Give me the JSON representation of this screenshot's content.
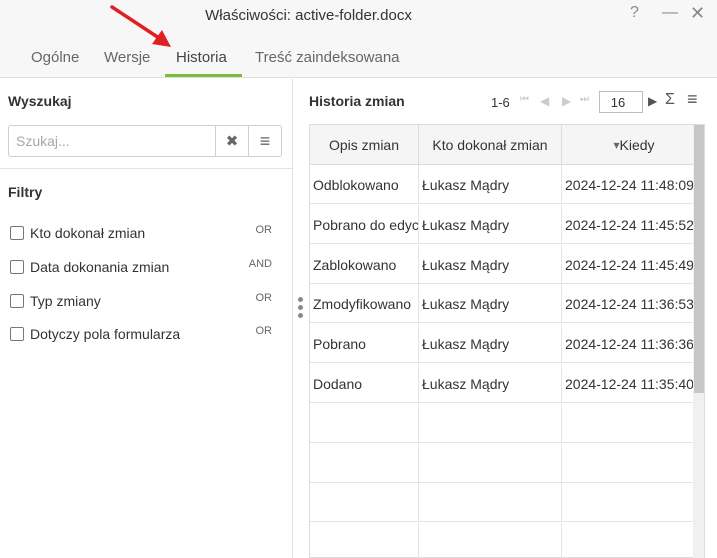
{
  "window": {
    "title": "Właściwości: active-folder.docx"
  },
  "tabs": [
    {
      "label": "Ogólne"
    },
    {
      "label": "Wersje"
    },
    {
      "label": "Historia"
    },
    {
      "label": "Treść zaindeksowana"
    }
  ],
  "left": {
    "search_title": "Wyszukaj",
    "search_placeholder": "Szukaj...",
    "filters_title": "Filtry",
    "filters": [
      {
        "label": "Kto dokonał zmian",
        "op": "OR"
      },
      {
        "label": "Data dokonania zmian",
        "op": "AND"
      },
      {
        "label": "Typ zmiany",
        "op": "OR"
      },
      {
        "label": "Dotyczy pola formularza",
        "op": "OR"
      }
    ]
  },
  "history": {
    "title": "Historia zmian",
    "range": "1-6",
    "page_size": "16",
    "columns": [
      "Opis zmian",
      "Kto dokonał zmian",
      "Kiedy"
    ],
    "sort_indicator": "▾",
    "rows": [
      [
        "Odblokowano",
        "Łukasz Mądry",
        "2024-12-24 11:48:09"
      ],
      [
        "Pobrano do edycji",
        "Łukasz Mądry",
        "2024-12-24 11:45:52"
      ],
      [
        "Zablokowano",
        "Łukasz Mądry",
        "2024-12-24 11:45:49"
      ],
      [
        "Zmodyfikowano",
        "Łukasz Mądry",
        "2024-12-24 11:36:53"
      ],
      [
        "Pobrano",
        "Łukasz Mądry",
        "2024-12-24 11:36:36"
      ],
      [
        "Dodano",
        "Łukasz Mądry",
        "2024-12-24 11:35:40"
      ]
    ]
  },
  "icons": {
    "help": "?",
    "minimize": "—",
    "close": "✕",
    "clear": "✖",
    "menu": "≡",
    "first": "⏮",
    "prev": "◀",
    "next": "▶",
    "last": "⏭",
    "sum": "Σ"
  },
  "colors": {
    "accent": "#79bd3b",
    "arrow": "#e02020"
  }
}
